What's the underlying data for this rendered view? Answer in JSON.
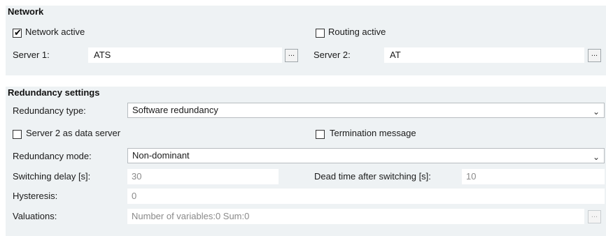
{
  "network": {
    "title": "Network",
    "network_active_label": "Network active",
    "network_active_checked": true,
    "routing_active_label": "Routing active",
    "routing_active_checked": false,
    "server1_label": "Server 1:",
    "server1_value": "ATS",
    "server2_label": "Server 2:",
    "server2_value": "AT",
    "browse_label": "..."
  },
  "redundancy": {
    "title": "Redundancy settings",
    "type_label": "Redundancy type:",
    "type_value": "Software redundancy",
    "server2_data_label": "Server 2 as data server",
    "server2_data_checked": false,
    "termination_label": "Termination message",
    "termination_checked": false,
    "mode_label": "Redundancy mode:",
    "mode_value": "Non-dominant",
    "switching_delay_label": "Switching delay [s]:",
    "switching_delay_value": "30",
    "dead_time_label": "Dead time after switching [s]:",
    "dead_time_value": "10",
    "hysteresis_label": "Hysteresis:",
    "hysteresis_value": "0",
    "valuations_label": "Valuations:",
    "valuations_value": "Number of variables:0 Sum:0",
    "browse_label": "..."
  },
  "icons": {
    "checkmark": "check-icon",
    "dropdown": "chevron-down-icon"
  }
}
